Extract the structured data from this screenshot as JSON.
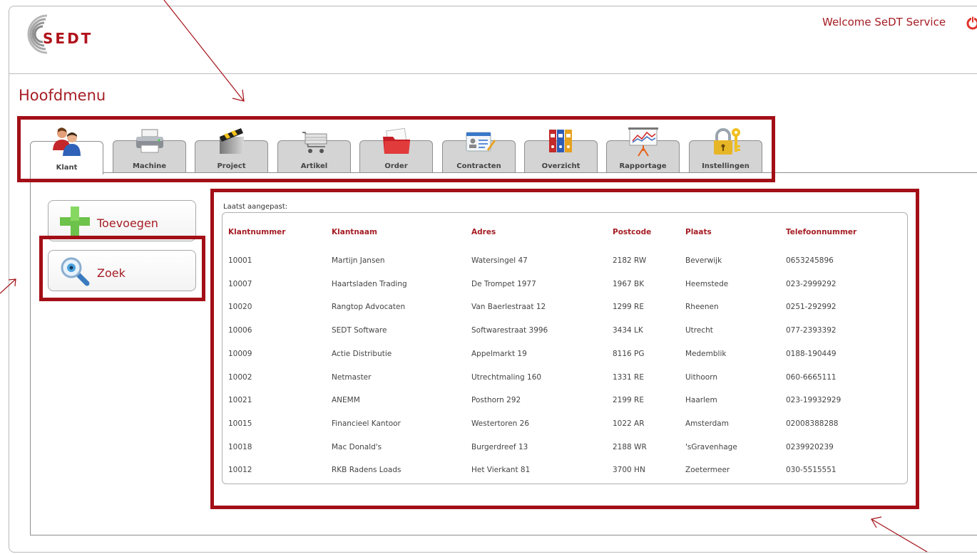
{
  "header": {
    "logo_text": "SEDT",
    "welcome": "Welcome SeDT Service",
    "power_icon": "power-icon"
  },
  "page_title": "Hoofdmenu",
  "tabs": [
    {
      "label": "Klant",
      "icon": "users-icon",
      "active": true
    },
    {
      "label": "Machine",
      "icon": "printer-icon",
      "active": false
    },
    {
      "label": "Project",
      "icon": "clapperboard-icon",
      "active": false
    },
    {
      "label": "Artikel",
      "icon": "cart-icon",
      "active": false
    },
    {
      "label": "Order",
      "icon": "folder-icon",
      "active": false
    },
    {
      "label": "Contracten",
      "icon": "id-card-icon",
      "active": false
    },
    {
      "label": "Overzicht",
      "icon": "binders-icon",
      "active": false
    },
    {
      "label": "Rapportage",
      "icon": "presentation-icon",
      "active": false
    },
    {
      "label": "Instellingen",
      "icon": "lock-key-icon",
      "active": false
    }
  ],
  "sidebar": {
    "add_label": "Toevoegen",
    "search_label": "Zoek"
  },
  "table": {
    "caption": "Laatst aangepast:",
    "columns": [
      "Klantnummer",
      "Klantnaam",
      "Adres",
      "Postcode",
      "Plaats",
      "Telefoonnummer"
    ],
    "rows": [
      [
        "10001",
        "Martijn Jansen",
        "Watersingel 47",
        "2182 RW",
        "Beverwijk",
        "0653245896"
      ],
      [
        "10007",
        "Haartsladen Trading",
        "De Trompet 1977",
        "1967 BK",
        "Heemstede",
        "023-2999292"
      ],
      [
        "10020",
        "Rangtop Advocaten",
        "Van Baerlestraat 12",
        "1299 RE",
        "Rheenen",
        "0251-292992"
      ],
      [
        "10006",
        "SEDT Software",
        "Softwarestraat 3996",
        "3434 LK",
        "Utrecht",
        "077-2393392"
      ],
      [
        "10009",
        "Actie Distributie",
        "Appelmarkt 19",
        "8116 PG",
        "Medemblik",
        "0188-190449"
      ],
      [
        "10002",
        "Netmaster",
        "Utrechtmaling 160",
        "1331 RE",
        "Uithoorn",
        "060-6665111"
      ],
      [
        "10021",
        "ANEMM",
        "Posthorn 292",
        "2199 RE",
        "Haarlem",
        "023-19932929"
      ],
      [
        "10015",
        "Financieel Kantoor",
        "Westertoren 26",
        "1022 AR",
        "Amsterdam",
        "02008388288"
      ],
      [
        "10018",
        "Mac Donald's",
        "Burgerdreef 13",
        "2188 WR",
        "'sGravenhage",
        "0239920239"
      ],
      [
        "10012",
        "RKB Radens Loads",
        "Het Vierkant 81",
        "3700 HN",
        "Zoetermeer",
        "030-5515551"
      ]
    ]
  },
  "colors": {
    "accent": "#a51d24",
    "highlight": "#a30f17",
    "tab_inactive": "#d4d4d4"
  }
}
